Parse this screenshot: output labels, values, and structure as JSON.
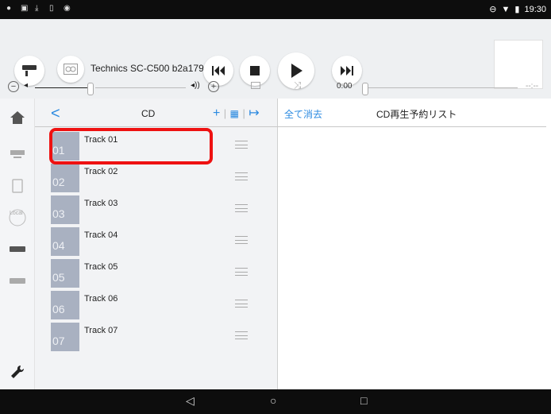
{
  "status": {
    "time": "19:30"
  },
  "device": {
    "name": "Technics SC-C500 b2a179"
  },
  "player": {
    "position": "0:00",
    "remaining": "--:--"
  },
  "list": {
    "title": "CD",
    "back": "<",
    "tracks": [
      {
        "num": "01",
        "name": "Track 01"
      },
      {
        "num": "02",
        "name": "Track 02"
      },
      {
        "num": "03",
        "name": "Track 03"
      },
      {
        "num": "04",
        "name": "Track 04"
      },
      {
        "num": "05",
        "name": "Track 05"
      },
      {
        "num": "06",
        "name": "Track 06"
      },
      {
        "num": "07",
        "name": "Track 07"
      }
    ]
  },
  "queue": {
    "clear": "全て消去",
    "title": "CD再生予約リスト"
  },
  "nav": {
    "local_label": "Local"
  },
  "colors": {
    "accent": "#2b8ae0",
    "highlight": "#ee1111"
  }
}
